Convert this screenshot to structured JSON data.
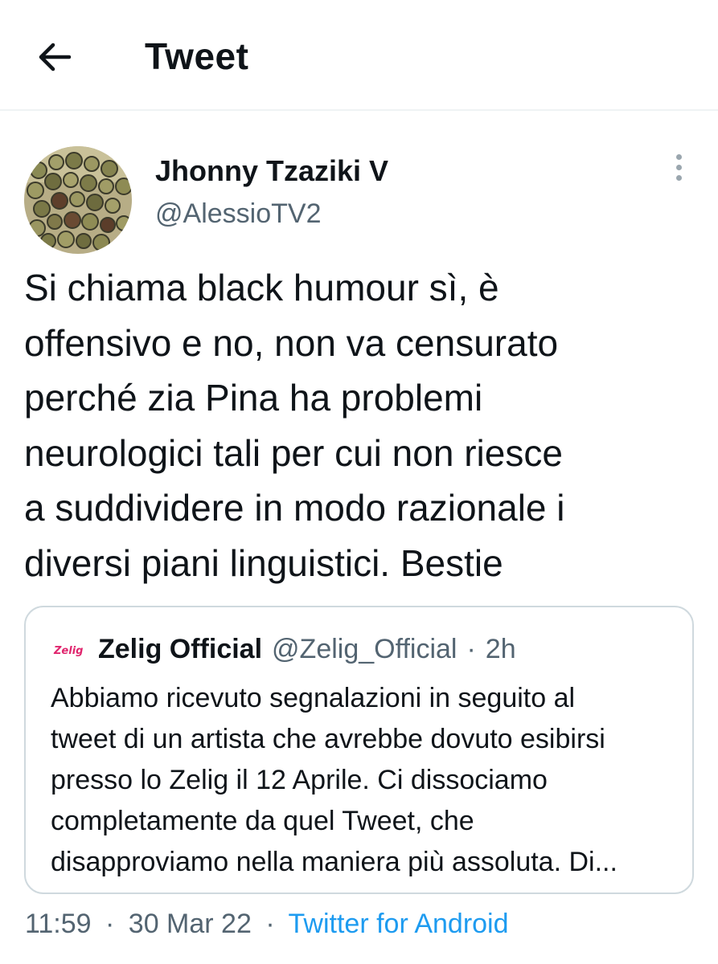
{
  "header": {
    "title": "Tweet",
    "back_icon": "arrow-left-icon"
  },
  "tweet": {
    "author_name": "Jhonny Tzaziki V",
    "author_handle": "@AlessioTV2",
    "text_lines": [
      "Si chiama black humour sì, è",
      "offensivo e no, non va censurato",
      "perché zia Pina ha problemi",
      "neurologici tali per cui non riesce",
      "a suddividere in modo razionale i",
      "diversi piani linguistici. Bestie"
    ],
    "more_icon": "more-vertical-icon",
    "timestamp_time": "11:59",
    "separator": "·",
    "timestamp_date": "30 Mar 22",
    "source": "Twitter for Android"
  },
  "quoted": {
    "logo_text": "Zelig",
    "name": "Zelig Official",
    "handle": "@Zelig_Official",
    "separator": "·",
    "age": "2h",
    "text_lines": [
      "Abbiamo ricevuto segnalazioni in seguito al",
      "tweet di un artista che avrebbe dovuto esibirsi",
      "presso lo Zelig il 12 Aprile. Ci dissociamo",
      "completamente da quel Tweet, che",
      "disapproviamo nella maniera più assoluta. Di..."
    ]
  },
  "colors": {
    "text_primary": "#0f1419",
    "text_secondary": "#536471",
    "link": "#1d9bf0",
    "border": "#cfd9de"
  }
}
